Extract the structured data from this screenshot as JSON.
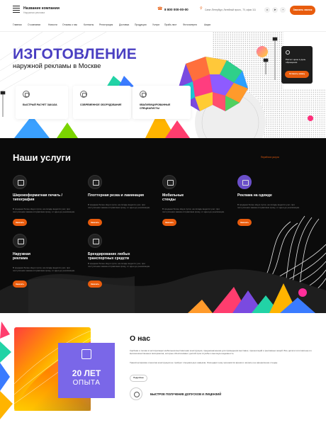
{
  "header": {
    "company_name": "Название компании",
    "tagline": "Наружная реклама",
    "phone": "8 800 000-00-00",
    "address": "Санкт-Петербург, Литейный просп., 70, офис 111",
    "social": [
      "vk-icon",
      "telegram-icon",
      "whatsapp-icon"
    ],
    "callback_label": "Заказать звонок"
  },
  "nav": {
    "items": [
      "Главная",
      "О компании",
      "Новости",
      "Отзывы о нас",
      "Контакты",
      "Регистрация",
      "Доставка",
      "Продукция",
      "Услуги",
      "Прайс-лист",
      "Фотогалерея",
      "Акции"
    ]
  },
  "hero": {
    "title": "ИЗГОТОВЛЕНИЕ",
    "subtitle": "наружной рекламы в Москве",
    "features": [
      {
        "icon": "clock-icon",
        "text": "БЫСТРЫЙ РАСЧЕТ ЗАКАЗА"
      },
      {
        "icon": "gear-icon",
        "text": "СОВРЕМЕННОЕ ОБОРУДОВАНИЕ"
      },
      {
        "icon": "helmet-icon",
        "text": "КВАЛИФИЦИРОВАННЫЕ СПЕЦИАЛИСТЫ"
      }
    ],
    "promo": {
      "text": "Расчет цены в день обращения",
      "button": "Оставить заявку"
    },
    "colors": {
      "title": "#4a3fc2",
      "accent": "#e85c0d"
    }
  },
  "services": {
    "title": "Наши услуги",
    "link": "Перейти в услуги",
    "items": [
      {
        "icon": "printer-icon",
        "title": "Широкоформатная печать / типография",
        "desc": "В среднем более 2ед в сутки, на складе ведется учет, при поступлении заказа отправляем сразу, от идеи до реализации.",
        "button": "Заказать"
      },
      {
        "icon": "cutter-icon",
        "title": "Плоттерная резка и ламинация",
        "desc": "В среднем более 2ед в сутки, на складе ведется учет, при поступлении заказа отправляем сразу, от идеи до реализации.",
        "button": "Заказать"
      },
      {
        "icon": "stand-icon",
        "title": "Мобильные стенды",
        "desc": "В среднем более 2ед в сутки, на складе ведется учет, при поступлении заказа отправляем сразу, от идеи до реализации.",
        "button": "Заказать"
      },
      {
        "icon": "shirt-icon",
        "title": "Реклама на одежде",
        "desc": "В среднем более 2ед в сутки, на складе ведется учет, при поступлении заказа отправляем сразу, от идеи до реализации.",
        "button": "Заказать"
      },
      {
        "icon": "billboard-icon",
        "title": "Наружная реклама",
        "desc": "В среднем более 2ед в сутки, на складе ведется учет, при поступлении заказа отправляем сразу, от идеи до реализации.",
        "button": "Заказать"
      },
      {
        "icon": "truck-icon",
        "title": "Брендирование любых транспортных средств",
        "desc": "В среднем более 2ед в сутки, на складе ведется учет, при поступлении заказа отправляем сразу, от идеи до реализации.",
        "button": "Заказать"
      }
    ]
  },
  "about": {
    "title": "О нас",
    "p1": "Удобная и легкая в эксплуатации мобильная выставочная конструкция, предназначенная для проведения выставок, презентаций и рекламных акций. Все детали изготовлены из высококачественных материалов, которые обеспечивают долгий срок службы и высокую надежность.",
    "p2": "Транспортировка и монтаж конструкции не требуют специальных навыков, благодаря чему экономятся время и затраты на оформление стенда.",
    "more_button": "Подробнее",
    "fast_text": "БЫСТРОЕ ПОЛУЧЕНИЕ ДОПУСКОВ И ЛИЦЕНЗИЙ",
    "badge_number": "20 ЛЕТ",
    "badge_label": "ОПЫТА"
  }
}
